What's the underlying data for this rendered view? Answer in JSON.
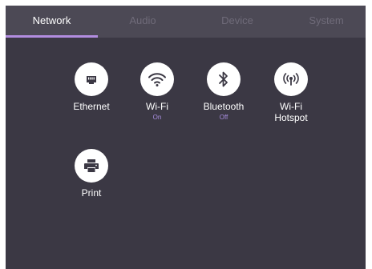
{
  "tabs": [
    {
      "label": "Network",
      "active": true
    },
    {
      "label": "Audio",
      "active": false
    },
    {
      "label": "Device",
      "active": false
    },
    {
      "label": "System",
      "active": false
    }
  ],
  "network_items": [
    {
      "label": "Ethernet",
      "icon": "ethernet-icon"
    },
    {
      "label": "Wi-Fi",
      "status": "On",
      "icon": "wifi-icon"
    },
    {
      "label": "Bluetooth",
      "status": "Off",
      "icon": "bluetooth-icon"
    },
    {
      "label": "Wi-Fi\nHotspot",
      "icon": "hotspot-icon"
    },
    {
      "label": "Print",
      "icon": "printer-icon"
    }
  ],
  "colors": {
    "background": "#3b3844",
    "tab_bar": "#4c4955",
    "accent": "#b28de0",
    "inactive_tab_text": "#6f6b79",
    "status_text": "#a98ee0"
  }
}
